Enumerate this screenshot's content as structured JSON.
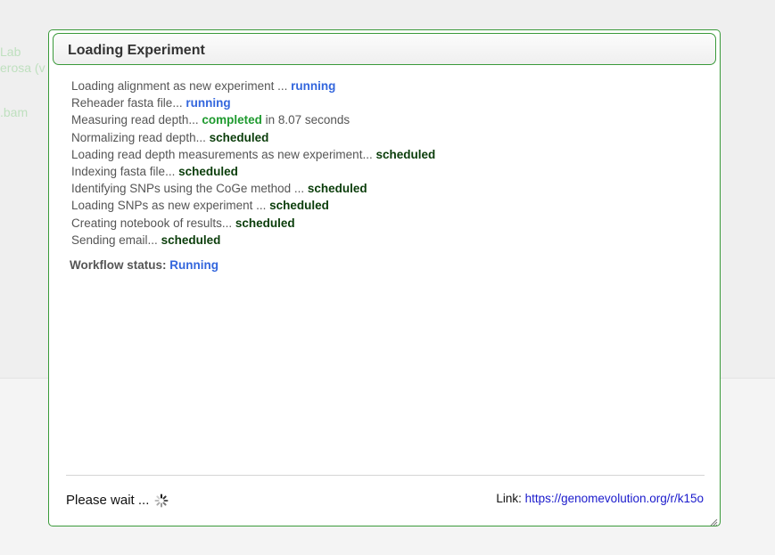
{
  "background": {
    "fragments": [
      "Lab",
      "erosa (v",
      ".bam"
    ]
  },
  "dialog": {
    "title": "Loading Experiment",
    "steps": [
      {
        "text": "Loading alignment as new experiment ... ",
        "status": "running",
        "suffix": ""
      },
      {
        "text": "Reheader fasta file... ",
        "status": "running",
        "suffix": ""
      },
      {
        "text": "Measuring read depth... ",
        "status": "completed",
        "suffix": " in 8.07 seconds"
      },
      {
        "text": "Normalizing read depth... ",
        "status": "scheduled",
        "suffix": ""
      },
      {
        "text": "Loading read depth measurements as new experiment... ",
        "status": "scheduled",
        "suffix": ""
      },
      {
        "text": "Indexing fasta file... ",
        "status": "scheduled",
        "suffix": ""
      },
      {
        "text": "Identifying SNPs using the CoGe method ... ",
        "status": "scheduled",
        "suffix": ""
      },
      {
        "text": "Loading SNPs as new experiment ... ",
        "status": "scheduled",
        "suffix": ""
      },
      {
        "text": "Creating notebook of results... ",
        "status": "scheduled",
        "suffix": ""
      },
      {
        "text": "Sending email... ",
        "status": "scheduled",
        "suffix": ""
      }
    ],
    "workflow_label": "Workflow status: ",
    "workflow_status": "Running",
    "wait_text": "Please wait ... ",
    "link_label": "Link: ",
    "link_url": "https://genomevolution.org/r/k15o"
  },
  "colors": {
    "running": "#3366dd",
    "completed": "#1e9a2e",
    "scheduled": "#0a3d0a",
    "border": "#3a9a3a"
  },
  "icons": {
    "spinner": "loading-spinner-icon",
    "resize": "resize-grip-icon"
  }
}
